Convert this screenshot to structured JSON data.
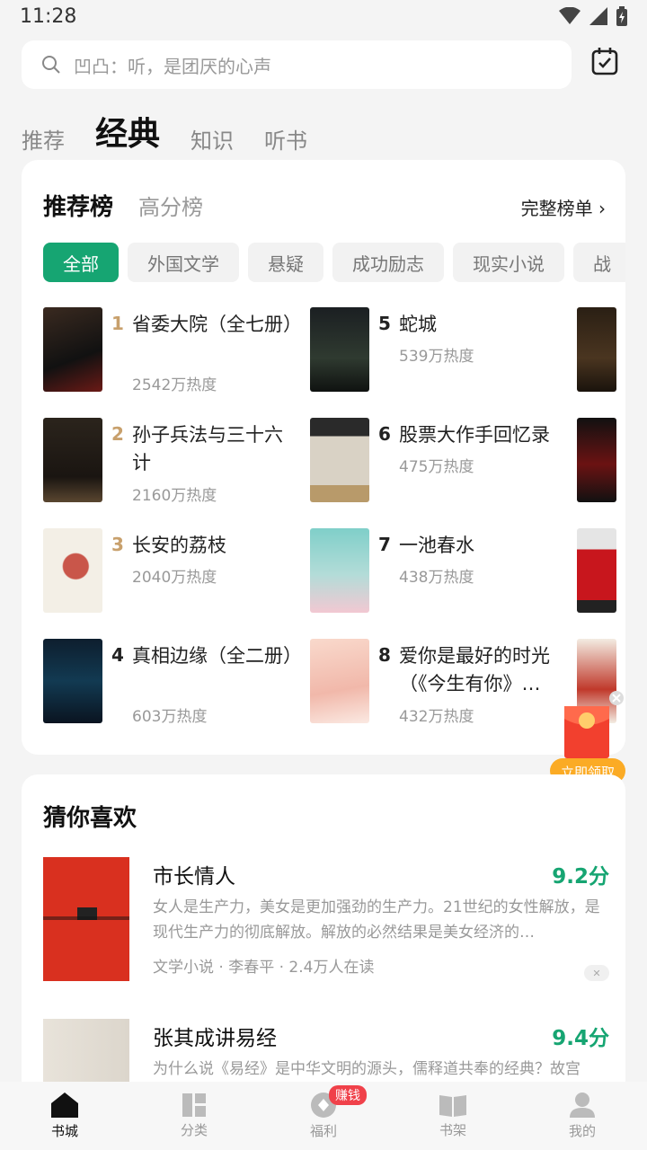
{
  "status": {
    "time": "11:28"
  },
  "search": {
    "placeholder": "凹凸：听，是团厌的心声"
  },
  "tabs": [
    "推荐",
    "经典",
    "知识",
    "听书"
  ],
  "ranking": {
    "title": "推荐榜",
    "alt_title": "高分榜",
    "full_list": "完整榜单",
    "chips": [
      "全部",
      "外国文学",
      "悬疑",
      "成功励志",
      "现实小说",
      "战"
    ],
    "books": [
      {
        "rank": "1",
        "title": "省委大院（全七册）",
        "heat": "2542万热度"
      },
      {
        "rank": "2",
        "title": "孙子兵法与三十六计",
        "heat": "2160万热度"
      },
      {
        "rank": "3",
        "title": "长安的荔枝",
        "heat": "2040万热度"
      },
      {
        "rank": "4",
        "title": "真相边缘（全二册）",
        "heat": "603万热度"
      },
      {
        "rank": "5",
        "title": "蛇城",
        "heat": "539万热度"
      },
      {
        "rank": "6",
        "title": "股票大作手回忆录",
        "heat": "475万热度"
      },
      {
        "rank": "7",
        "title": "一池春水",
        "heat": "438万热度"
      },
      {
        "rank": "8",
        "title": "爱你是最好的时光（《今生有你》…",
        "heat": "432万热度"
      }
    ]
  },
  "red_packet": {
    "label": "立即领取"
  },
  "guess": {
    "title": "猜你喜欢",
    "items": [
      {
        "title": "市长情人",
        "score": "9.2分",
        "desc": "女人是生产力，美女是更加强劲的生产力。21世纪的女性解放，是现代生产力的彻底解放。解放的必然结果是美女经济的…",
        "meta": "文学小说 · 李春平 · 2.4万人在读"
      },
      {
        "title": "张其成讲易经",
        "score": "9.4分",
        "desc": "为什么说《易经》是中华文明的源头，儒释道共奉的经典？故宫"
      }
    ]
  },
  "nav": {
    "items": [
      "书城",
      "分类",
      "福利",
      "书架",
      "我的"
    ],
    "badge": "赚钱"
  },
  "colors": {
    "accent": "#16a572",
    "gold": "#c8a06c",
    "badge": "#f0414a"
  }
}
